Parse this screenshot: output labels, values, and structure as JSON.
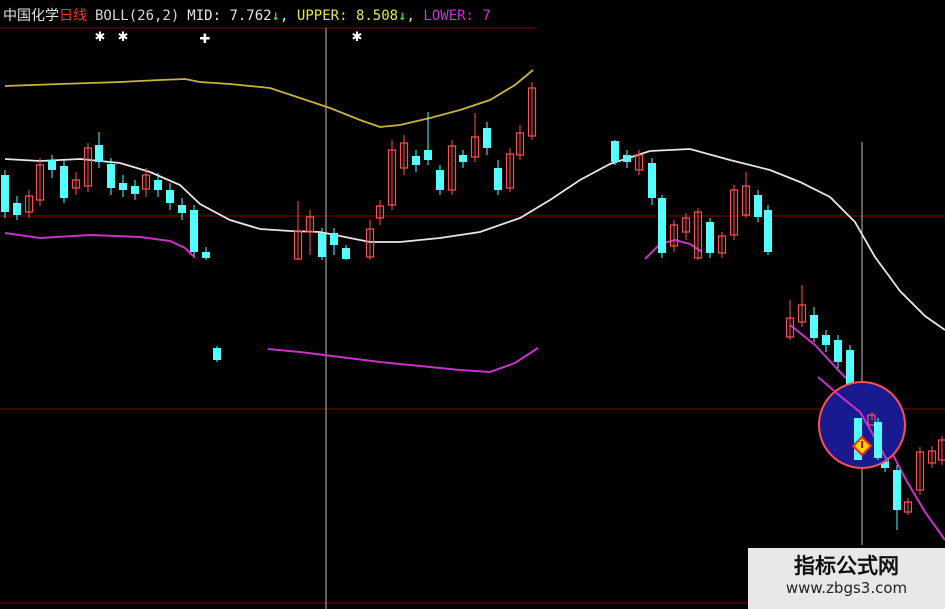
{
  "header": {
    "stock_name": "中国化学",
    "period": "日线",
    "indicator": "BOLL(26,2)",
    "mid_label": "MID:",
    "mid_value": "7.762",
    "upper_label": "UPPER:",
    "upper_value": "8.508",
    "lower_label": "LOWER:",
    "lower_value": "7",
    "arrow_down": "↓",
    "separator": ","
  },
  "watermark": {
    "title": "指标公式网",
    "url": "www.zbgs3.com"
  },
  "colors": {
    "background": "#000000",
    "rise": "#ff5050",
    "fall": "#54ffff",
    "mid_line": "#e6e6e6",
    "upper_line": "#c8b43c",
    "lower_line": "#c832c8",
    "grid": "#8a0000",
    "crosshair": "#bbbbbb",
    "highlight_circle": "#1a1a90"
  },
  "chart_data": {
    "type": "candlestick",
    "indicator": "BOLL(26,2)",
    "series_names": [
      "MID",
      "UPPER",
      "LOWER"
    ],
    "signal_markers": [
      "✱",
      "✱",
      "✚",
      "✱"
    ]
  }
}
